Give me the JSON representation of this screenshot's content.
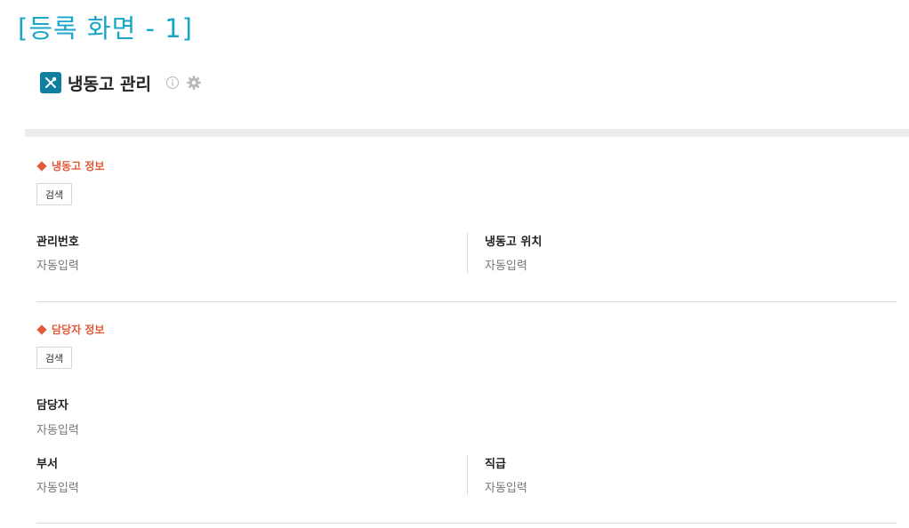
{
  "screen_label": "[등록 화면 - 1]",
  "header": {
    "title": "냉동고 관리",
    "app_icon": "tools-icon",
    "info_icon": "info-icon",
    "settings_icon": "gear-icon"
  },
  "colors": {
    "screen_label": "#1aa6c8",
    "app_icon_bg": "#0f7fa0",
    "section_title": "#e05a3a"
  },
  "freezer_section": {
    "title": "냉동고 정보",
    "search_label": "검색",
    "fields": [
      {
        "label": "관리번호",
        "value": "자동입력"
      },
      {
        "label": "냉동고 위치",
        "value": "자동입력"
      }
    ]
  },
  "manager_section": {
    "title": "담당자 정보",
    "search_label": "검색",
    "fields": [
      {
        "label": "담당자",
        "value": "자동입력"
      },
      {
        "label": "부서",
        "value": "자동입력"
      },
      {
        "label": "직급",
        "value": "자동입력"
      }
    ]
  }
}
